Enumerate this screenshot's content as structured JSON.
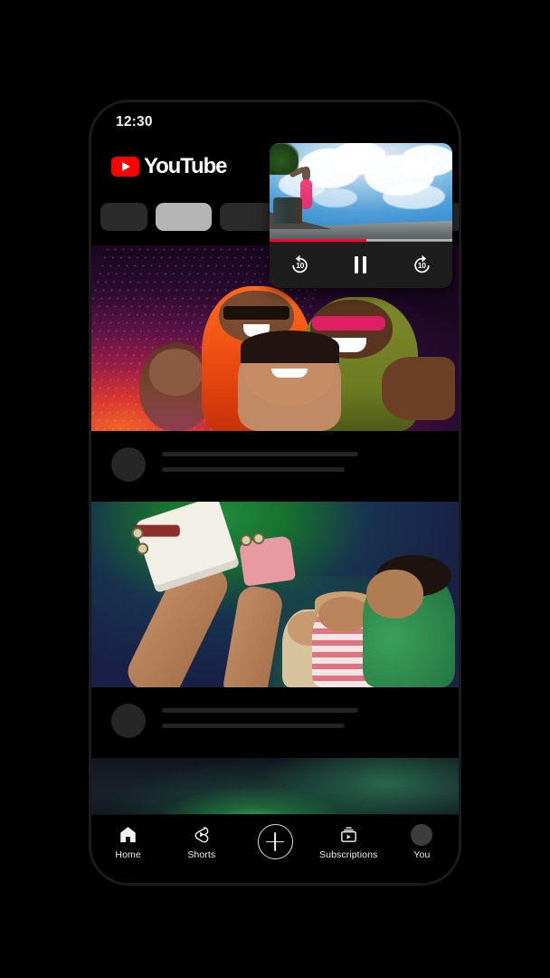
{
  "app": {
    "name": "YouTube",
    "logo_icon": "youtube-logo-icon"
  },
  "status_bar": {
    "time": "12:30"
  },
  "chips": [
    {
      "id": "chip-1",
      "state": "unselected"
    },
    {
      "id": "chip-2",
      "state": "selected"
    },
    {
      "id": "chip-3",
      "state": "unselected"
    },
    {
      "id": "chip-4",
      "state": "unselected"
    }
  ],
  "feed": {
    "cards": [
      {
        "thumbnail_description": "Group of smiling friends with sunglasses on purple magenta gradient background",
        "title_placeholder": "",
        "channel_placeholder": "",
        "loading": true
      },
      {
        "thumbnail_description": "Roller skaters with legs up against dark navy and green background",
        "title_placeholder": "",
        "channel_placeholder": "",
        "loading": true
      },
      {
        "thumbnail_description": "Green aurora borealis over dark mountain ridge",
        "title_placeholder": "",
        "channel_placeholder": "",
        "loading": true
      }
    ]
  },
  "pip_player": {
    "video_description": "Skateboarder airborne against blue sky with clouds",
    "close_label": "Close",
    "close_icon": "close-icon",
    "progress_percent": 53,
    "progress_color": "#ff0033",
    "controls": [
      {
        "id": "rewind",
        "icon": "replay-10-icon",
        "label": "10"
      },
      {
        "id": "pause",
        "icon": "pause-icon",
        "label": ""
      },
      {
        "id": "forward",
        "icon": "forward-10-icon",
        "label": "10"
      }
    ],
    "playback_state": "playing"
  },
  "bottom_nav": {
    "items": [
      {
        "label": "Home",
        "icon": "home-icon",
        "active": true
      },
      {
        "label": "Shorts",
        "icon": "shorts-icon",
        "active": false
      },
      {
        "label": "",
        "icon": "create-plus-icon",
        "active": false
      },
      {
        "label": "Subscriptions",
        "icon": "subscriptions-icon",
        "active": false
      },
      {
        "label": "You",
        "icon": "account-avatar-icon",
        "active": false
      }
    ]
  },
  "colors": {
    "brand_red": "#ff0000",
    "progress_red": "#ff0033",
    "background": "#000000",
    "chip_selected": "#b5b5b5",
    "chip_unselected": "#2b2b2b",
    "skeleton": "#232323"
  }
}
